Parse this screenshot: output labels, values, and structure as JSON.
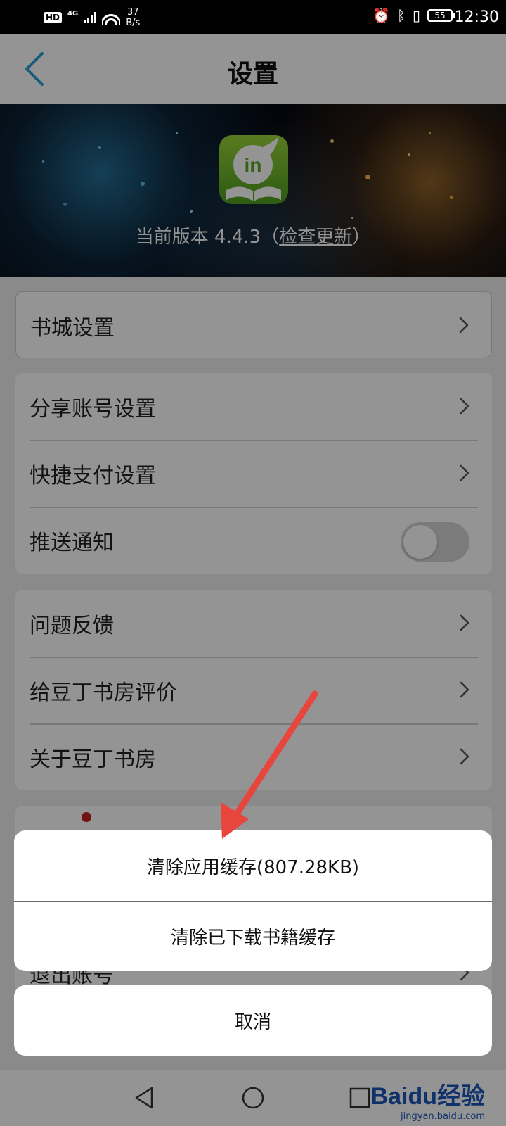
{
  "status_bar": {
    "network_badge": "HD",
    "signal_label": "4G",
    "speed_value": "37",
    "speed_unit": "B/s",
    "battery": "55",
    "time": "12:30"
  },
  "header": {
    "title": "设置"
  },
  "banner": {
    "version_prefix": "当前版本 4.4.3（",
    "check_update": "检查更新",
    "version_suffix": "）"
  },
  "groups": {
    "bookstore": {
      "label": "书城设置"
    },
    "account": {
      "share": "分享账号设置",
      "payment": "快捷支付设置",
      "push": "推送通知",
      "push_enabled": false
    },
    "about": {
      "feedback": "问题反馈",
      "rate": "给豆丁书房评价",
      "about": "关于豆丁书房"
    },
    "bottom": {
      "logout": "退出账号"
    }
  },
  "action_sheet": {
    "clear_app_cache": "清除应用缓存(807.28KB)",
    "clear_book_cache": "清除已下载书籍缓存",
    "cancel": "取消"
  },
  "watermark": {
    "brand": "Baidu经验",
    "url": "jingyan.baidu.com"
  },
  "colors": {
    "accent": "#2a9fd6",
    "annotation_arrow": "#e8453c",
    "logo_green": "#6ab82c"
  }
}
